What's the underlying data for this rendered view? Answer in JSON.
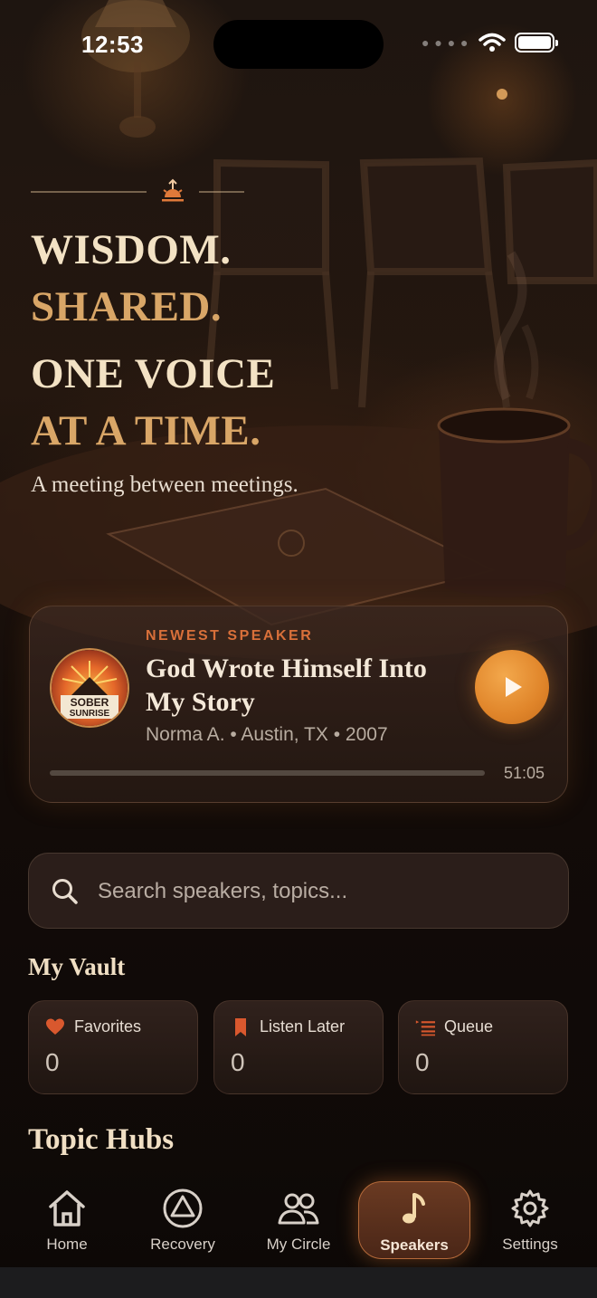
{
  "status_bar": {
    "time": "12:53"
  },
  "hero": {
    "line1": "WISDOM.",
    "line2": "SHARED.",
    "line3": "ONE VOICE",
    "line4": "AT A TIME.",
    "tagline": "A meeting between meetings."
  },
  "newest_speaker": {
    "label": "NEWEST SPEAKER",
    "title": "God Wrote Himself Into My Story",
    "meta": "Norma A. • Austin, TX • 2007",
    "duration": "51:05",
    "progress": 0.0,
    "logo_text_line1": "SOBER",
    "logo_text_line2": "SUNRISE"
  },
  "search": {
    "placeholder": "Search speakers, topics..."
  },
  "vault": {
    "title": "My Vault",
    "cards": [
      {
        "label": "Favorites",
        "count": "0",
        "icon": "heart-icon"
      },
      {
        "label": "Listen Later",
        "count": "0",
        "icon": "bookmark-icon"
      },
      {
        "label": "Queue",
        "count": "0",
        "icon": "queue-list-icon"
      }
    ]
  },
  "topic_hubs": {
    "title": "Topic Hubs"
  },
  "tabs": [
    {
      "label": "Home",
      "icon": "home-icon"
    },
    {
      "label": "Recovery",
      "icon": "triangle-circle-icon"
    },
    {
      "label": "My Circle",
      "icon": "people-icon"
    },
    {
      "label": "Speakers",
      "icon": "music-note-icon",
      "active": true
    },
    {
      "label": "Settings",
      "icon": "gear-icon"
    }
  ],
  "colors": {
    "accent": "#e0852a",
    "label_orange": "#d9703a",
    "gold": "#d9a667",
    "cream": "#f3e2c4"
  }
}
